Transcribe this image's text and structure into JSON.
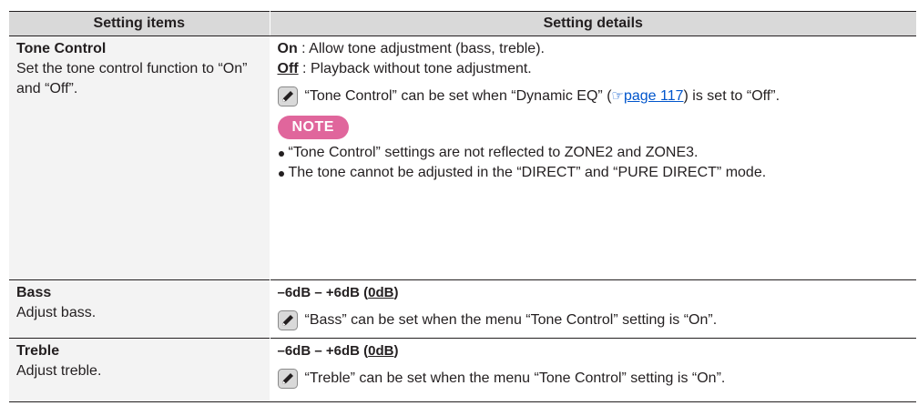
{
  "table": {
    "header": {
      "col1": "Setting items",
      "col2": "Setting details"
    },
    "tone_control": {
      "name": "Tone Control",
      "description": "Set the tone control function to “On” and “Off”.",
      "options": [
        {
          "key": "On",
          "text": " : Allow tone adjustment (bass, treble)."
        },
        {
          "key": "Off",
          "text": " : Playback without tone adjustment."
        }
      ],
      "tip_before": "“Tone Control” can be set when “Dynamic EQ” (",
      "tip_link": "page 117",
      "tip_after": ") is set to “Off”.",
      "note_label": "NOTE",
      "notes": [
        "“Tone Control” settings are not reflected to ZONE2 and ZONE3.",
        "The tone cannot be adjusted in the “DIRECT” and “PURE DIRECT” mode."
      ]
    },
    "bass": {
      "name": "Bass",
      "description": "Adjust bass.",
      "range_prefix": "–6dB – +6dB (",
      "range_default": "0dB",
      "range_suffix": ")",
      "tip": "“Bass” can be set when the menu “Tone Control” setting is “On”."
    },
    "treble": {
      "name": "Treble",
      "description": "Adjust treble.",
      "range_prefix": "–6dB – +6dB (",
      "range_default": "0dB",
      "range_suffix": ")",
      "tip": "“Treble” can be set when the menu “Tone Control” setting is “On”."
    }
  },
  "icons": {
    "pencil": "pencil-icon",
    "hand_pointer": "pointing-hand-icon"
  },
  "colors": {
    "header_bg": "#d9d9d9",
    "item_col_bg": "#f3f3f3",
    "note_badge": "#e0669c",
    "link": "#0055cc"
  }
}
